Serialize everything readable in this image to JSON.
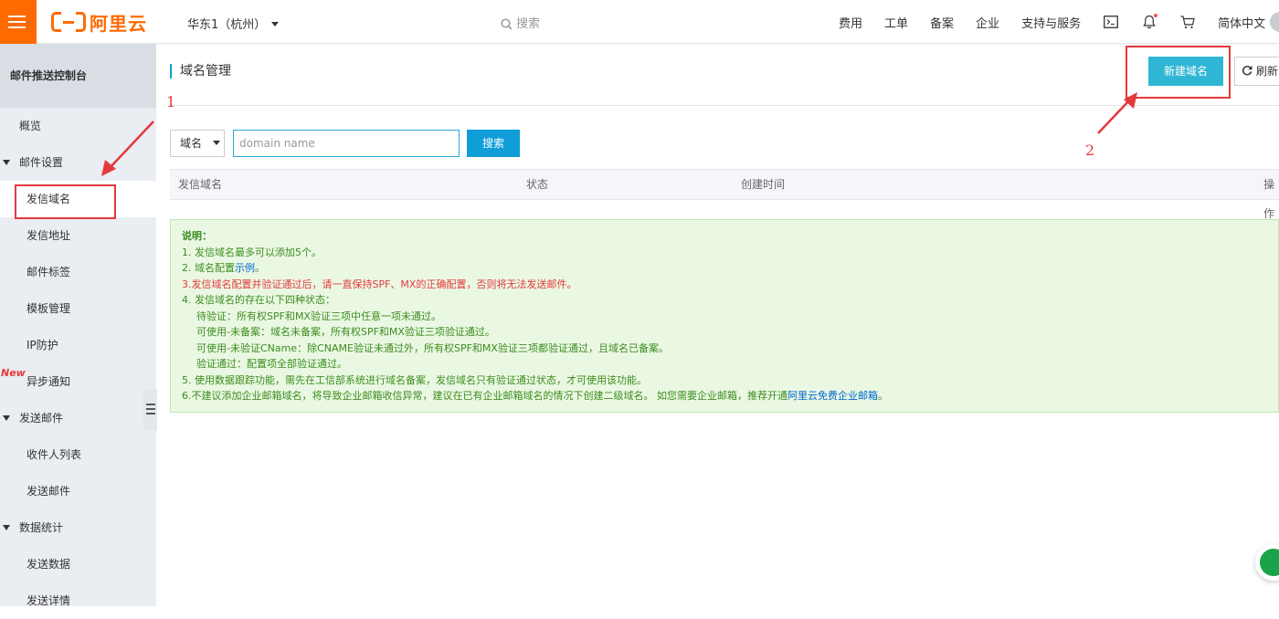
{
  "header": {
    "logo_text": "阿里云",
    "region": "华东1（杭州）",
    "search_placeholder": "搜索",
    "nav": [
      "费用",
      "工单",
      "备案",
      "企业",
      "支持与服务"
    ],
    "language": "简体中文",
    "icons": [
      "menu-icon",
      "terminal-icon",
      "bell-icon",
      "cart-icon"
    ]
  },
  "sidebar": {
    "title": "邮件推送控制台",
    "items": [
      {
        "label": "概览",
        "level": "top"
      },
      {
        "label": "邮件设置",
        "level": "group"
      },
      {
        "label": "发信域名",
        "level": "child",
        "active": true
      },
      {
        "label": "发信地址",
        "level": "child"
      },
      {
        "label": "邮件标签",
        "level": "child"
      },
      {
        "label": "模板管理",
        "level": "child"
      },
      {
        "label": "IP防护",
        "level": "child"
      },
      {
        "label": "异步通知",
        "level": "child"
      },
      {
        "label": "发送邮件",
        "level": "group"
      },
      {
        "label": "收件人列表",
        "level": "child"
      },
      {
        "label": "发送邮件",
        "level": "child"
      },
      {
        "label": "数据统计",
        "level": "group"
      },
      {
        "label": "发送数据",
        "level": "child"
      },
      {
        "label": "发送详情",
        "level": "child"
      }
    ],
    "new_badge": "New"
  },
  "main": {
    "title": "域名管理",
    "new_button": "新建域名",
    "refresh_button": "刷新",
    "filter_select": "域名",
    "search_placeholder": "domain name",
    "search_button": "搜索",
    "table_headers": [
      "发信域名",
      "状态",
      "创建时间",
      "操作"
    ]
  },
  "notice": {
    "title": "说明：",
    "line1": "1. 发信域名最多可以添加5个。",
    "line2_prefix": "2. 域名配置",
    "line2_link": "示例",
    "line2_suffix": "。",
    "line3": "3.发信域名配置并验证通过后，请一直保持SPF、MX的正确配置，否则将无法发送邮件。",
    "line4": "4. 发信域名的存在以下四种状态：",
    "line4a": "待验证：所有权SPF和MX验证三项中任意一项未通过。",
    "line4b": "可使用-未备案：域名未备案，所有权SPF和MX验证三项验证通过。",
    "line4c": "可使用-未验证CName：除CNAME验证未通过外，所有权SPF和MX验证三项都验证通过，且域名已备案。",
    "line4d": "验证通过：配置项全部验证通过。",
    "line5": "5. 使用数据跟踪功能，需先在工信部系统进行域名备案，发信域名只有验证通过状态，才可使用该功能。",
    "line6_prefix": "6.不建议添加企业邮箱域名，将导致企业邮箱收信异常，建议在已有企业邮箱域名的情况下创建二级域名。 如您需要企业邮箱，推荐开通",
    "line6_link": "阿里云免费企业邮箱",
    "line6_suffix": "。"
  },
  "annotations": {
    "label1": "1",
    "label2": "2",
    "color": "#e4393c"
  },
  "colors": {
    "brand": "#ff6a00",
    "primary_button": "#2fb6d4",
    "search_button": "#0f9ed8",
    "notice_bg": "#eaf8e3",
    "notice_text": "#3c8c1e"
  }
}
